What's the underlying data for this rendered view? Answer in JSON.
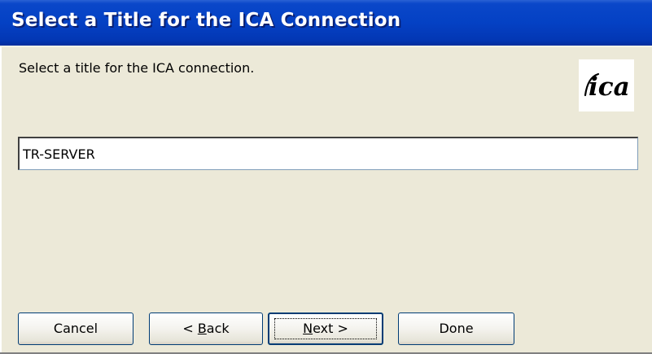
{
  "window": {
    "title": "Select a Title for the ICA Connection"
  },
  "content": {
    "instruction": "Select a title for the ICA connection.",
    "logo_text": "ica",
    "logo_icon": "ica-logo-icon"
  },
  "form": {
    "title_value": "TR-SERVER"
  },
  "buttons": {
    "cancel": "Cancel",
    "back_prefix": "< ",
    "back_mnemonic": "B",
    "back_rest": "ack",
    "next_mnemonic": "N",
    "next_rest": "ext >",
    "done": "Done"
  },
  "colors": {
    "titlebar": "#0441c4",
    "dialog_background": "#ece9d8",
    "button_border": "#003c74"
  }
}
